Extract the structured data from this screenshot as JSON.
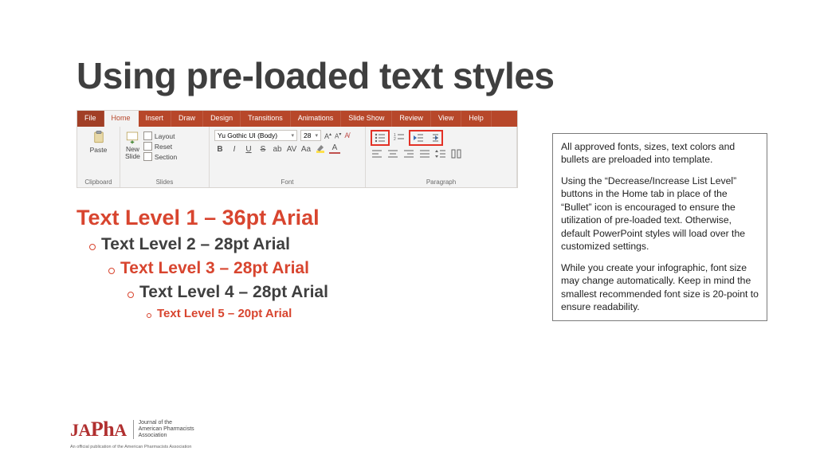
{
  "title": "Using pre-loaded text styles",
  "ribbon": {
    "tabs": [
      "File",
      "Home",
      "Insert",
      "Draw",
      "Design",
      "Transitions",
      "Animations",
      "Slide Show",
      "Review",
      "View",
      "Help"
    ],
    "active_tab": "Home",
    "clipboard": {
      "paste": "Paste",
      "label": "Clipboard"
    },
    "slides": {
      "new_slide": "New\nSlide",
      "layout": "Layout",
      "reset": "Reset",
      "section": "Section",
      "label": "Slides"
    },
    "font": {
      "family": "Yu Gothic UI (Body)",
      "size": "28",
      "label": "Font"
    },
    "paragraph": {
      "label": "Paragraph"
    }
  },
  "levels": {
    "l1": "Text Level 1 – 36pt Arial",
    "l2": "Text Level 2 – 28pt Arial",
    "l3": "Text Level 3 – 28pt Arial",
    "l4": "Text Level 4 – 28pt Arial",
    "l5": "Text Level 5 – 20pt Arial"
  },
  "infobox": {
    "p1": "All approved fonts, sizes, text colors and bullets are preloaded into template.",
    "p2": "Using the “Decrease/Increase List Level” buttons in the Home tab in place of the “Bullet” icon is encouraged to ensure the utilization of pre-loaded text. Otherwise, default PowerPoint styles will load over the customized settings.",
    "p3": "While you create your infographic, font size may change automatically. Keep in mind the smallest recommended font size is 20-point to ensure readability."
  },
  "footer": {
    "logo_main": "JAPhA",
    "logo_sub1": "Journal of the",
    "logo_sub2": "American Pharmacists",
    "logo_sub3": "Association",
    "tagline": "An official publication of the American Pharmacists Association"
  }
}
